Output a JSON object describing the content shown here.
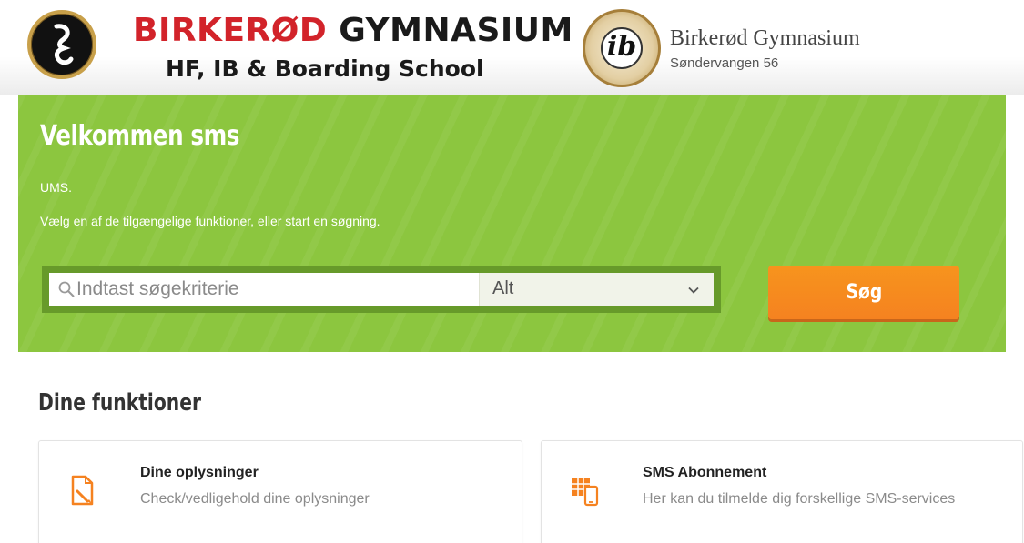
{
  "header": {
    "brand_title_red": "BIRKERØD",
    "brand_title_black": "GYMNASIUM",
    "brand_subtitle": "HF, IB & Boarding School",
    "ib_logo_text": "ib",
    "school_name": "Birkerød Gymnasium",
    "school_address": "Søndervangen 56"
  },
  "banner": {
    "welcome": "Velkommen sms",
    "line1": "UMS.",
    "line2": "Vælg en af de tilgængelige funktioner, eller start en søgning.",
    "background_color": "#8cc63f"
  },
  "search": {
    "placeholder": "Indtast søgekriterie",
    "select_value": "Alt",
    "button_label": "Søg",
    "button_color": "#f7941d"
  },
  "functions": {
    "title": "Dine funktioner",
    "cards": [
      {
        "icon": "document-edit-icon",
        "title": "Dine oplysninger",
        "description": "Check/vedligehold dine oplysninger"
      },
      {
        "icon": "sms-phone-icon",
        "title": "SMS Abonnement",
        "description": "Her kan du tilmelde dig forskellige SMS-services"
      }
    ]
  }
}
